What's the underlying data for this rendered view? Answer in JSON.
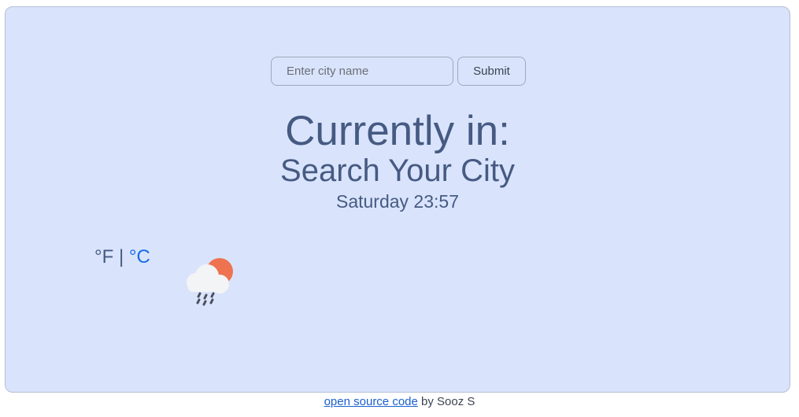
{
  "search": {
    "placeholder": "Enter city name",
    "value": "",
    "submit_label": "Submit"
  },
  "heading": {
    "title": "Currently in:",
    "city": "Search Your City",
    "date_time": "Saturday 23:57"
  },
  "units": {
    "fahrenheit_label": "°F",
    "separator": "|",
    "celsius_label": "°C",
    "active": "celsius"
  },
  "weather": {
    "icon": "partly-cloudy-rain-icon"
  },
  "footer": {
    "link_text": "open source code",
    "suffix": "by Sooz S"
  },
  "colors": {
    "card_background": "#d9e4fc",
    "heading_text": "#465a82",
    "active_unit": "#1a6be6",
    "link": "#1a5fd1"
  }
}
